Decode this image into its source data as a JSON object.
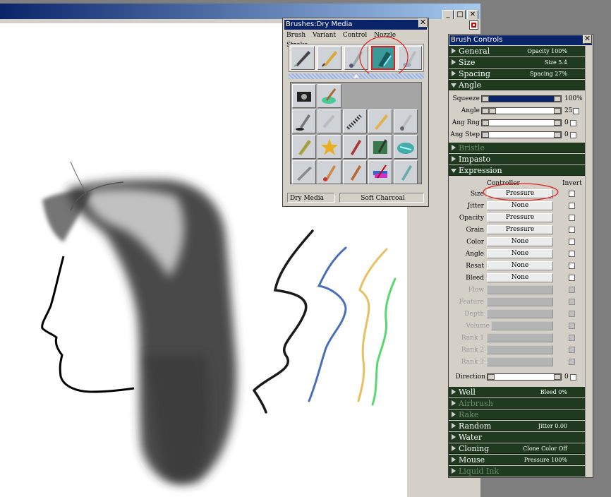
{
  "window": {
    "min_glyph": "_",
    "max_glyph": "□",
    "close_glyph": "✕"
  },
  "brushes_palette": {
    "title": "Brushes:Dry Media",
    "close_glyph": "✕",
    "menu": [
      "Brush",
      "Variant",
      "Control",
      "Nozzle",
      "Stroke"
    ],
    "status_category": "Dry Media",
    "status_variant": "Soft Charcoal"
  },
  "brush_controls": {
    "title": "Brush Controls",
    "close_glyph": "✕",
    "sections_top": [
      {
        "label": "General",
        "value": "Opacity 100%"
      },
      {
        "label": "Size",
        "value": "Size 5.4"
      },
      {
        "label": "Spacing",
        "value": "Spacing 27%"
      },
      {
        "label": "Angle",
        "value": ""
      }
    ],
    "angle_rows": [
      {
        "label": "Squeeze",
        "value": "100%"
      },
      {
        "label": "Angle",
        "value": "25"
      },
      {
        "label": "Ang Rng",
        "value": "0"
      },
      {
        "label": "Ang Step",
        "value": "0"
      }
    ],
    "mid_sections": [
      {
        "label": "Bristle"
      },
      {
        "label": "Impasto"
      },
      {
        "label": "Expression"
      }
    ],
    "expression": {
      "controller_header": "Controller",
      "invert_header": "Invert",
      "rows": [
        {
          "label": "Size",
          "value": "Pressure"
        },
        {
          "label": "Jitter",
          "value": "None"
        },
        {
          "label": "Opacity",
          "value": "Pressure"
        },
        {
          "label": "Grain",
          "value": "Pressure"
        },
        {
          "label": "Color",
          "value": "None"
        },
        {
          "label": "Angle",
          "value": "None"
        },
        {
          "label": "Resat",
          "value": "None"
        },
        {
          "label": "Bleed",
          "value": "None"
        },
        {
          "label": "Flow",
          "value": ""
        },
        {
          "label": "Feature",
          "value": ""
        },
        {
          "label": "Depth",
          "value": ""
        },
        {
          "label": "Volume",
          "value": ""
        },
        {
          "label": "Rank 1",
          "value": ""
        },
        {
          "label": "Rank 2",
          "value": ""
        },
        {
          "label": "Rank 3",
          "value": ""
        }
      ],
      "direction_label": "Direction",
      "direction_value": "0"
    },
    "sections_bottom": [
      {
        "label": "Well",
        "value": "Bleed 0%"
      },
      {
        "label": "Airbrush",
        "value": ""
      },
      {
        "label": "Rake",
        "value": ""
      },
      {
        "label": "Random",
        "value": "Jitter 0.00"
      },
      {
        "label": "Water",
        "value": ""
      },
      {
        "label": "Cloning",
        "value": "Clone Color Off"
      },
      {
        "label": "Mouse",
        "value": "Pressure 100%"
      },
      {
        "label": "Liquid Ink",
        "value": ""
      }
    ]
  },
  "colors": {
    "section_bg": "#1f3a1f",
    "highlight_red": "#e02020",
    "stroke_blue": "#4a6fb8",
    "stroke_yellow": "#e8c060",
    "stroke_green": "#58d870"
  }
}
